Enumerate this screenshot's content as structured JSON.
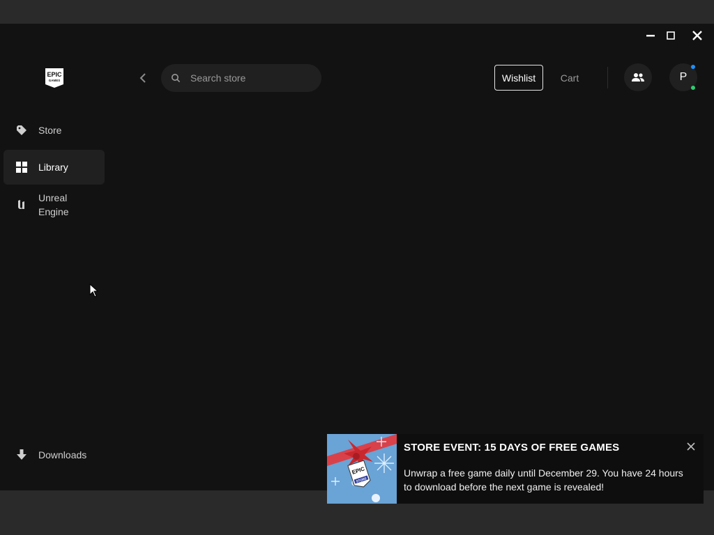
{
  "window": {
    "controls": [
      "minimize",
      "maximize",
      "close"
    ]
  },
  "logo": {
    "icon": "epic-games-logo",
    "text_top": "EPIC",
    "text_bottom": "GAMES"
  },
  "header": {
    "back_icon": "chevron-left-icon",
    "search": {
      "placeholder": "Search store",
      "value": "",
      "icon": "search-icon"
    },
    "wishlist_label": "Wishlist",
    "cart_label": "Cart",
    "friends_icon": "friends-icon",
    "avatar_initial": "P",
    "status_colors": {
      "notification": "#1e90ff",
      "online": "#2ecc71"
    }
  },
  "sidebar": {
    "items": [
      {
        "label": "Store",
        "icon": "tag-icon",
        "active": false
      },
      {
        "label": "Library",
        "icon": "grid-icon",
        "active": true
      },
      {
        "label": "Unreal Engine",
        "icon": "unreal-engine-icon",
        "active": false
      }
    ],
    "downloads": {
      "label": "Downloads",
      "icon": "download-icon"
    }
  },
  "toast": {
    "title": "STORE EVENT: 15 DAYS OF FREE GAMES",
    "body": "Unwrap a free game daily until December 29. You have 24 hours to download before the next game is revealed!",
    "image_label_top": "EPIC",
    "image_label_bottom": "STORE",
    "close_icon": "close-icon"
  },
  "colors": {
    "app_background": "#121212",
    "frame_background": "#2a2a2a",
    "surface": "#202020",
    "muted_text": "#9a9a9a"
  }
}
